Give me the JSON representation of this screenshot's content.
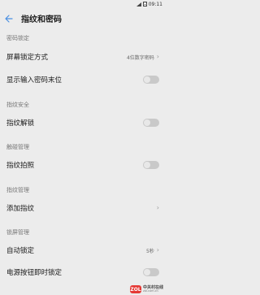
{
  "status_bar": {
    "time": "09:11"
  },
  "header": {
    "title": "指纹和密码",
    "back_icon": "arrow-left-icon"
  },
  "sections": [
    {
      "header": "密码锁定",
      "items": [
        {
          "label": "屏幕锁定方式",
          "value": "4位数字密码",
          "control": "chevron"
        },
        {
          "label": "显示输入密码末位",
          "control": "toggle",
          "on": false
        }
      ]
    },
    {
      "header": "指纹安全",
      "items": [
        {
          "label": "指纹解锁",
          "control": "toggle",
          "on": false
        }
      ]
    },
    {
      "header": "触碰管理",
      "items": [
        {
          "label": "指纹拍照",
          "control": "toggle",
          "on": false
        }
      ]
    },
    {
      "header": "指纹管理",
      "items": [
        {
          "label": "添加指纹",
          "control": "chevron"
        }
      ]
    },
    {
      "header": "锁屏管理",
      "items": [
        {
          "label": "自动锁定",
          "value": "5秒",
          "control": "chevron"
        },
        {
          "label": "电源按钮即时锁定",
          "control": "toggle",
          "on": false
        }
      ]
    }
  ],
  "watermark": {
    "logo": "ZOL",
    "text_cn": "中关村在线",
    "text_en": "zol.com.cn"
  },
  "colors": {
    "background": "#ececec",
    "toggle_off": "#c9c9c9",
    "accent": "#4a90e2"
  }
}
